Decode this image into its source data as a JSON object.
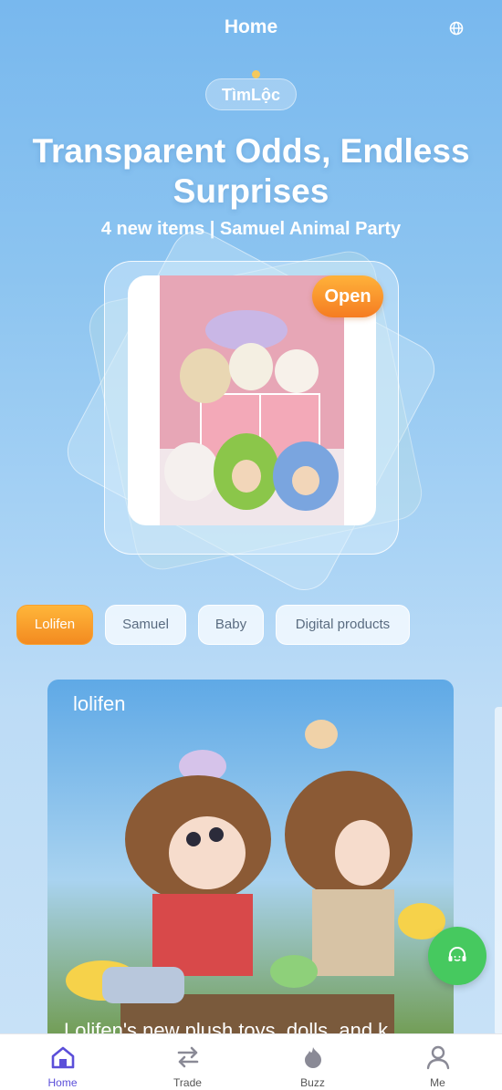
{
  "header": {
    "title": "Home",
    "globe_icon": "globe-icon"
  },
  "hero": {
    "brand": "TìmLộc",
    "headline": "Transparent Odds, Endless Surprises",
    "subline": "4 new items | Samuel Animal Party",
    "open_label": "Open"
  },
  "tabs": [
    {
      "label": "Lolifen",
      "active": true
    },
    {
      "label": "Samuel",
      "active": false
    },
    {
      "label": "Baby",
      "active": false
    },
    {
      "label": "Digital products",
      "active": false
    }
  ],
  "feature": {
    "brand_mark": "lolifen",
    "caption": "Lolifen's new plush toys, dolls, and k..."
  },
  "support_icon": "headset-icon",
  "nav": [
    {
      "label": "Home",
      "icon": "home-icon",
      "active": true
    },
    {
      "label": "Trade",
      "icon": "swap-icon",
      "active": false
    },
    {
      "label": "Buzz",
      "icon": "flame-icon",
      "active": false
    },
    {
      "label": "Me",
      "icon": "user-icon",
      "active": false
    }
  ],
  "colors": {
    "accent": "#5b4fd9",
    "orange": "#f38a20",
    "green": "#46c95f"
  }
}
